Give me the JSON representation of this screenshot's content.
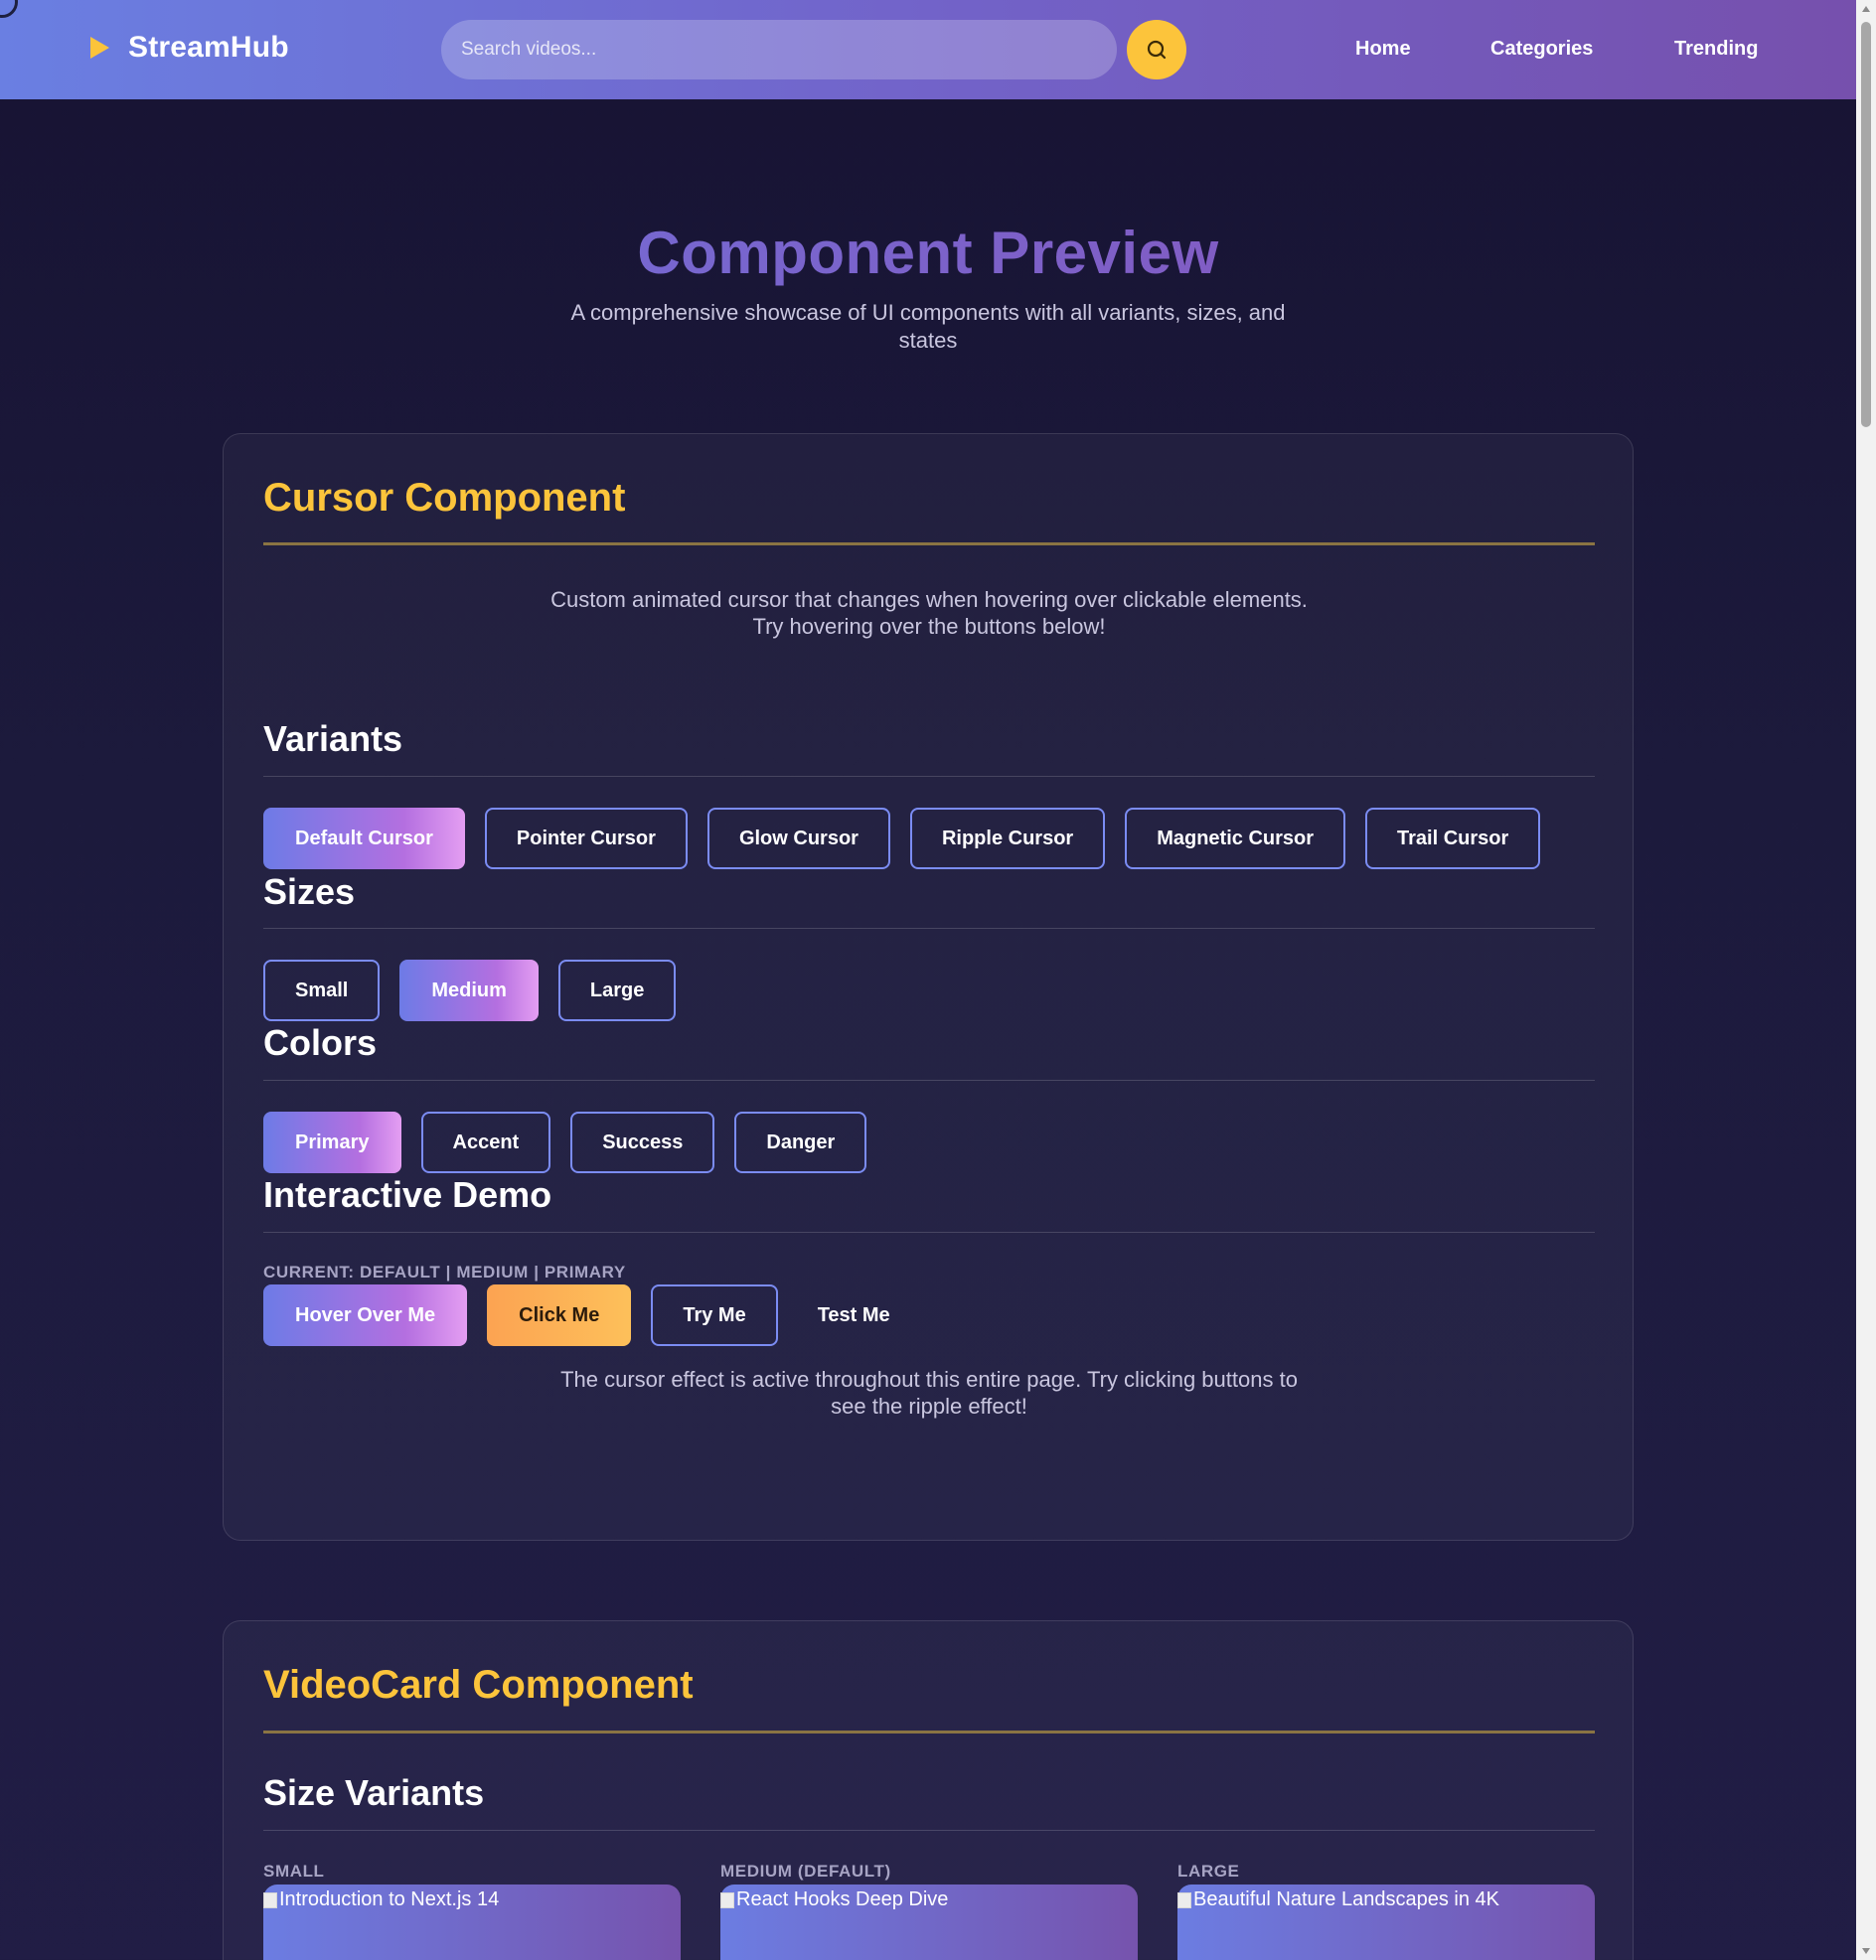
{
  "header": {
    "brand": "StreamHub",
    "search_placeholder": "Search videos...",
    "nav": [
      "Home",
      "Categories",
      "Trending"
    ]
  },
  "hero": {
    "title": "Component Preview",
    "subtitle": "A comprehensive showcase of UI components with all variants, sizes, and states"
  },
  "cursor_section": {
    "title": "Cursor Component",
    "description": "Custom animated cursor that changes when hovering over clickable elements. Try hovering over the buttons below!",
    "variants_title": "Variants",
    "variants": [
      "Default Cursor",
      "Pointer Cursor",
      "Glow Cursor",
      "Ripple Cursor",
      "Magnetic Cursor",
      "Trail Cursor"
    ],
    "sizes_title": "Sizes",
    "sizes": [
      "Small",
      "Medium",
      "Large"
    ],
    "colors_title": "Colors",
    "colors": [
      "Primary",
      "Accent",
      "Success",
      "Danger"
    ],
    "demo_title": "Interactive Demo",
    "current_label": "CURRENT: DEFAULT | MEDIUM | PRIMARY",
    "demo_buttons": [
      "Hover Over Me",
      "Click Me",
      "Try Me",
      "Test Me"
    ],
    "demo_note": "The cursor effect is active throughout this entire page. Try clicking buttons to see the ripple effect!"
  },
  "videocard_section": {
    "title": "VideoCard Component",
    "size_variants_title": "Size Variants",
    "cards": [
      {
        "label": "SMALL",
        "alt": "Introduction to Next.js 14"
      },
      {
        "label": "MEDIUM (DEFAULT)",
        "alt": "React Hooks Deep Dive"
      },
      {
        "label": "LARGE",
        "alt": "Beautiful Nature Landscapes in 4K"
      }
    ]
  },
  "colors": {
    "accent": "#fcc43b",
    "header_gradient": [
      "#6a7fe2",
      "#7650ad"
    ],
    "button_border": "#7b8cf3"
  }
}
